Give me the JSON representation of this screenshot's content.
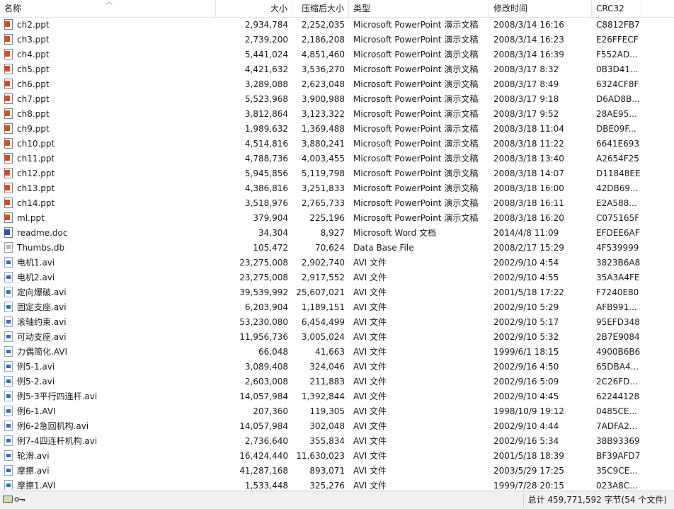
{
  "columns": {
    "name": "名称",
    "size": "大小",
    "packed": "压缩后大小",
    "type": "类型",
    "modified": "修改时间",
    "crc": "CRC32"
  },
  "files": [
    {
      "name": "ch2.ppt",
      "size": "2,934,784",
      "packed": "2,252,035",
      "type": "Microsoft PowerPoint 演示文稿",
      "modified": "2008/3/14 16:16",
      "crc": "C8812FB7",
      "icon": "ppt-file-icon"
    },
    {
      "name": "ch3.ppt",
      "size": "2,739,200",
      "packed": "2,186,208",
      "type": "Microsoft PowerPoint 演示文稿",
      "modified": "2008/3/14 16:23",
      "crc": "E26FFECF",
      "icon": "ppt-file-icon"
    },
    {
      "name": "ch4.ppt",
      "size": "5,441,024",
      "packed": "4,851,460",
      "type": "Microsoft PowerPoint 演示文稿",
      "modified": "2008/3/14 16:39",
      "crc": "F552AD...",
      "icon": "ppt-file-icon"
    },
    {
      "name": "ch5.ppt",
      "size": "4,421,632",
      "packed": "3,536,270",
      "type": "Microsoft PowerPoint 演示文稿",
      "modified": "2008/3/17 8:32",
      "crc": "0B3D41...",
      "icon": "ppt-file-icon"
    },
    {
      "name": "ch6.ppt",
      "size": "3,289,088",
      "packed": "2,623,048",
      "type": "Microsoft PowerPoint 演示文稿",
      "modified": "2008/3/17 8:49",
      "crc": "6324CF8F",
      "icon": "ppt-file-icon"
    },
    {
      "name": "ch7.ppt",
      "size": "5,523,968",
      "packed": "3,900,988",
      "type": "Microsoft PowerPoint 演示文稿",
      "modified": "2008/3/17 9:18",
      "crc": "D6AD8B...",
      "icon": "ppt-file-icon"
    },
    {
      "name": "ch8.ppt",
      "size": "3,812,864",
      "packed": "3,123,322",
      "type": "Microsoft PowerPoint 演示文稿",
      "modified": "2008/3/17 9:52",
      "crc": "28AE95...",
      "icon": "ppt-file-icon"
    },
    {
      "name": "ch9.ppt",
      "size": "1,989,632",
      "packed": "1,369,488",
      "type": "Microsoft PowerPoint 演示文稿",
      "modified": "2008/3/18 11:04",
      "crc": "DBE09F...",
      "icon": "ppt-file-icon"
    },
    {
      "name": "ch10.ppt",
      "size": "4,514,816",
      "packed": "3,880,241",
      "type": "Microsoft PowerPoint 演示文稿",
      "modified": "2008/3/18 11:22",
      "crc": "6641E693",
      "icon": "ppt-file-icon"
    },
    {
      "name": "ch11.ppt",
      "size": "4,788,736",
      "packed": "4,003,455",
      "type": "Microsoft PowerPoint 演示文稿",
      "modified": "2008/3/18 13:40",
      "crc": "A2654F25",
      "icon": "ppt-file-icon"
    },
    {
      "name": "ch12.ppt",
      "size": "5,945,856",
      "packed": "5,119,798",
      "type": "Microsoft PowerPoint 演示文稿",
      "modified": "2008/3/18 14:07",
      "crc": "D11848EE",
      "icon": "ppt-file-icon"
    },
    {
      "name": "ch13.ppt",
      "size": "4,386,816",
      "packed": "3,251,833",
      "type": "Microsoft PowerPoint 演示文稿",
      "modified": "2008/3/18 16:00",
      "crc": "42DB69...",
      "icon": "ppt-file-icon"
    },
    {
      "name": "ch14.ppt",
      "size": "3,518,976",
      "packed": "2,765,733",
      "type": "Microsoft PowerPoint 演示文稿",
      "modified": "2008/3/18 16:11",
      "crc": "E2A588...",
      "icon": "ppt-file-icon"
    },
    {
      "name": "ml.ppt",
      "size": "379,904",
      "packed": "225,196",
      "type": "Microsoft PowerPoint 演示文稿",
      "modified": "2008/3/18 16:20",
      "crc": "C075165F",
      "icon": "ppt-file-icon"
    },
    {
      "name": "readme.doc",
      "size": "34,304",
      "packed": "8,927",
      "type": "Microsoft Word 文档",
      "modified": "2014/4/8 11:09",
      "crc": "EFDEE6AF",
      "icon": "doc-file-icon"
    },
    {
      "name": "Thumbs.db",
      "size": "105,472",
      "packed": "70,624",
      "type": "Data Base File",
      "modified": "2008/2/17 15:29",
      "crc": "4F539999",
      "icon": "db-file-icon"
    },
    {
      "name": "电机1.avi",
      "size": "23,275,008",
      "packed": "2,902,740",
      "type": "AVI 文件",
      "modified": "2002/9/10 4:54",
      "crc": "3823B6A8",
      "icon": "avi-file-icon"
    },
    {
      "name": "电机2.avi",
      "size": "23,275,008",
      "packed": "2,917,552",
      "type": "AVI 文件",
      "modified": "2002/9/10 4:55",
      "crc": "35A3A4FE",
      "icon": "avi-file-icon"
    },
    {
      "name": "定向爆破.avi",
      "size": "39,539,992",
      "packed": "25,607,021",
      "type": "AVI 文件",
      "modified": "2001/5/18 17:22",
      "crc": "F7240E80",
      "icon": "avi-file-icon"
    },
    {
      "name": "固定支座.avi",
      "size": "6,203,904",
      "packed": "1,189,151",
      "type": "AVI 文件",
      "modified": "2002/9/10 5:29",
      "crc": "AFB991...",
      "icon": "avi-file-icon"
    },
    {
      "name": "滚轴约束.avi",
      "size": "53,230,080",
      "packed": "6,454,499",
      "type": "AVI 文件",
      "modified": "2002/9/10 5:17",
      "crc": "95EFD348",
      "icon": "avi-file-icon"
    },
    {
      "name": "可动支座.avi",
      "size": "11,956,736",
      "packed": "3,005,024",
      "type": "AVI 文件",
      "modified": "2002/9/10 5:32",
      "crc": "2B7E9084",
      "icon": "avi-file-icon"
    },
    {
      "name": "力偶简化.AVI",
      "size": "66,048",
      "packed": "41,663",
      "type": "AVI 文件",
      "modified": "1999/6/1 18:15",
      "crc": "4900B6B6",
      "icon": "avi-file-icon"
    },
    {
      "name": "例5-1.avi",
      "size": "3,089,408",
      "packed": "324,046",
      "type": "AVI 文件",
      "modified": "2002/9/16 4:50",
      "crc": "65DBA4...",
      "icon": "avi-file-icon"
    },
    {
      "name": "例5-2.avi",
      "size": "2,603,008",
      "packed": "211,883",
      "type": "AVI 文件",
      "modified": "2002/9/16 5:09",
      "crc": "2C26FD...",
      "icon": "avi-file-icon"
    },
    {
      "name": "例5-3平行四连杆.avi",
      "size": "14,057,984",
      "packed": "1,392,844",
      "type": "AVI 文件",
      "modified": "2002/9/10 4:45",
      "crc": "62244128",
      "icon": "avi-file-icon"
    },
    {
      "name": "例6-1.AVI",
      "size": "207,360",
      "packed": "119,305",
      "type": "AVI 文件",
      "modified": "1998/10/9 19:12",
      "crc": "0485CE...",
      "icon": "avi-file-icon"
    },
    {
      "name": "例6-2急回机构.avi",
      "size": "14,057,984",
      "packed": "302,048",
      "type": "AVI 文件",
      "modified": "2002/9/10 4:44",
      "crc": "7ADFA2...",
      "icon": "avi-file-icon"
    },
    {
      "name": "例7-4四连杆机构.avi",
      "size": "2,736,640",
      "packed": "355,834",
      "type": "AVI 文件",
      "modified": "2002/9/16 5:34",
      "crc": "38B93369",
      "icon": "avi-file-icon"
    },
    {
      "name": "轮滑.avi",
      "size": "16,424,440",
      "packed": "11,630,023",
      "type": "AVI 文件",
      "modified": "2001/5/18 18:39",
      "crc": "BF39AFD7",
      "icon": "avi-file-icon"
    },
    {
      "name": "摩擦.avi",
      "size": "41,287,168",
      "packed": "893,071",
      "type": "AVI 文件",
      "modified": "2003/5/29 17:25",
      "crc": "35C9CE...",
      "icon": "avi-file-icon"
    },
    {
      "name": "摩擦1.AVI",
      "size": "1,533,448",
      "packed": "325,276",
      "type": "AVI 文件",
      "modified": "1999/7/28 20:15",
      "crc": "023A8C...",
      "icon": "avi-file-icon"
    }
  ],
  "status": {
    "summary": "总计 459,771,592 字节(54 个文件)",
    "icons": [
      "drive-icon",
      "key-icon"
    ]
  },
  "colors": {
    "ppt": "#c5522b",
    "doc": "#2b5797",
    "avi": "#2f6fc2"
  }
}
